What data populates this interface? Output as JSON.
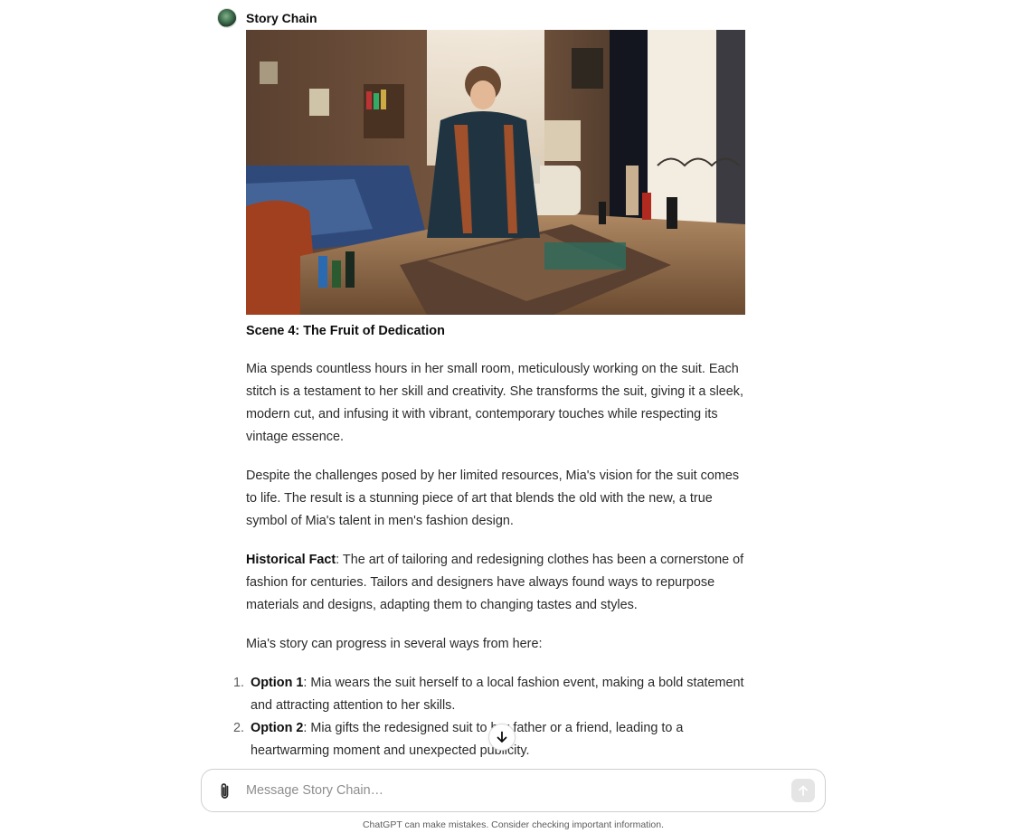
{
  "message": {
    "author": "Story Chain",
    "avatar_icon": "story-chain-avatar",
    "image_alt": "Young woman tailoring a brown suit jacket at a sewing table in a cozy room",
    "heading": "Scene 4: The Fruit of Dedication",
    "paragraphs": [
      "Mia spends countless hours in her small room, meticulously working on the suit. Each stitch is a testament to her skill and creativity. She transforms the suit, giving it a sleek, modern cut, and infusing it with vibrant, contemporary touches while respecting its vintage essence.",
      "Despite the challenges posed by her limited resources, Mia's vision for the suit comes to life. The result is a stunning piece of art that blends the old with the new, a true symbol of Mia's talent in men's fashion design."
    ],
    "fact_label": "Historical Fact",
    "fact_text": ": The art of tailoring and redesigning clothes has been a cornerstone of fashion for centuries. Tailors and designers have always found ways to repurpose materials and designs, adapting them to changing tastes and styles.",
    "options_intro": "Mia's story can progress in several ways from here:",
    "options": [
      {
        "number": "1.",
        "label": "Option 1",
        "text": ": Mia wears the suit herself to a local fashion event, making a bold statement and attracting attention to her skills."
      },
      {
        "number": "2.",
        "label": "Option 2",
        "text": ": Mia gifts the redesigned suit to her father or a friend, leading to a heartwarming moment and unexpected publicity."
      }
    ]
  },
  "scroll_button": {
    "icon": "arrow-down-icon"
  },
  "composer": {
    "placeholder": "Message Story Chain…",
    "attach_icon": "paperclip-icon",
    "send_icon": "arrow-up-icon"
  },
  "footer": {
    "disclaimer": "ChatGPT can make mistakes. Consider checking important information."
  },
  "colors": {
    "text": "#0d0d0d",
    "body_text": "#2b2b2b",
    "muted": "#5d5d5d",
    "border": "#cfcfcf",
    "send_bg": "#e5e5e5"
  }
}
